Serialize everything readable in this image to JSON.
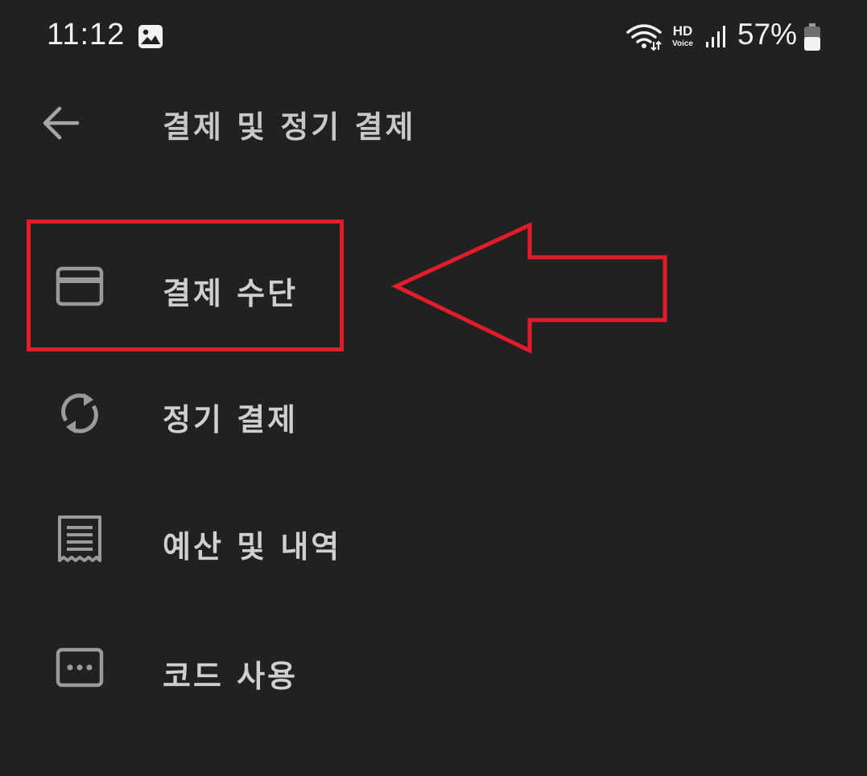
{
  "status_bar": {
    "time": "11:12",
    "battery_percent": "57%",
    "network_label": "HD",
    "network_sub_label": "Voice",
    "icons": [
      "photo-icon",
      "wifi-icon",
      "hd-voice-icon",
      "signal-icon",
      "battery-icon"
    ]
  },
  "header": {
    "title": "결제 및 정기 결제",
    "back_icon": "arrow-left-icon"
  },
  "menu": {
    "items": [
      {
        "label": "결제 수단",
        "icon": "credit-card-icon",
        "highlighted": true
      },
      {
        "label": "정기 결제",
        "icon": "sync-icon",
        "highlighted": false
      },
      {
        "label": "예산 및 내역",
        "icon": "receipt-icon",
        "highlighted": false
      },
      {
        "label": "코드 사용",
        "icon": "redeem-code-icon",
        "highlighted": false
      }
    ]
  },
  "annotation": {
    "color": "#e31c2a",
    "type": "arrow pointing left at highlighted item"
  },
  "colors": {
    "background": "#212121",
    "text": "#cfcfcf",
    "icon": "#9a9a9a",
    "status_text": "#f2f2f2"
  }
}
